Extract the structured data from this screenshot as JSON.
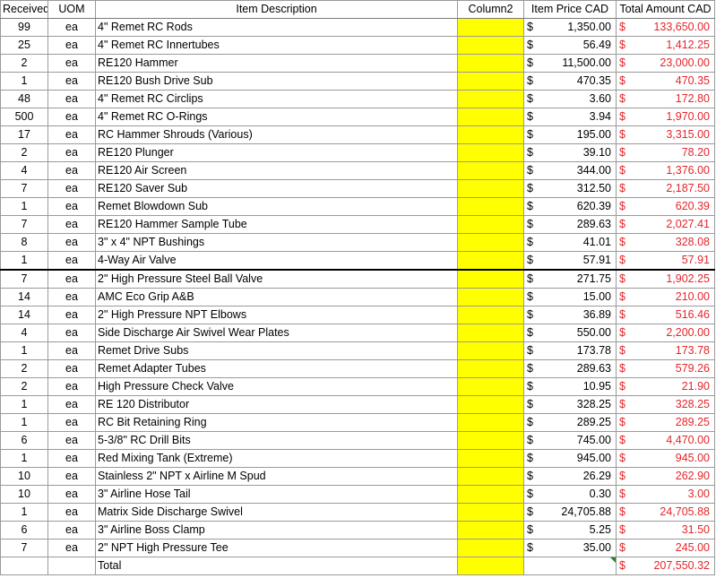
{
  "headers": {
    "received": "Received",
    "uom": "UOM",
    "description": "Item Description",
    "column2": "Column2",
    "price": "Item Price CAD",
    "total": "Total Amount CAD"
  },
  "currency_symbol": "$",
  "rows": [
    {
      "received": "99",
      "uom": "ea",
      "description": "4\" Remet RC Rods",
      "price": "1,350.00",
      "total": "133,650.00"
    },
    {
      "received": "25",
      "uom": "ea",
      "description": "4\" Remet RC Innertubes",
      "price": "56.49",
      "total": "1,412.25"
    },
    {
      "received": "2",
      "uom": "ea",
      "description": "RE120 Hammer",
      "price": "11,500.00",
      "total": "23,000.00"
    },
    {
      "received": "1",
      "uom": "ea",
      "description": "RE120 Bush Drive Sub",
      "price": "470.35",
      "total": "470.35"
    },
    {
      "received": "48",
      "uom": "ea",
      "description": "4\" Remet RC Circlips",
      "price": "3.60",
      "total": "172.80"
    },
    {
      "received": "500",
      "uom": "ea",
      "description": "4\" Remet RC O-Rings",
      "price": "3.94",
      "total": "1,970.00"
    },
    {
      "received": "17",
      "uom": "ea",
      "description": "RC Hammer Shrouds (Various)",
      "price": "195.00",
      "total": "3,315.00"
    },
    {
      "received": "2",
      "uom": "ea",
      "description": "RE120 Plunger",
      "price": "39.10",
      "total": "78.20"
    },
    {
      "received": "4",
      "uom": "ea",
      "description": "RE120 Air Screen",
      "price": "344.00",
      "total": "1,376.00"
    },
    {
      "received": "7",
      "uom": "ea",
      "description": "RE120 Saver Sub",
      "price": "312.50",
      "total": "2,187.50"
    },
    {
      "received": "1",
      "uom": "ea",
      "description": "Remet Blowdown Sub",
      "price": "620.39",
      "total": "620.39"
    },
    {
      "received": "7",
      "uom": "ea",
      "description": "RE120 Hammer Sample Tube",
      "price": "289.63",
      "total": "2,027.41"
    },
    {
      "received": "8",
      "uom": "ea",
      "description": "3\" x 4\" NPT Bushings",
      "price": "41.01",
      "total": "328.08"
    },
    {
      "received": "1",
      "uom": "ea",
      "description": "4-Way Air Valve",
      "price": "57.91",
      "total": "57.91"
    },
    {
      "received": "7",
      "uom": "ea",
      "description": "2\" High Pressure Steel Ball Valve",
      "price": "271.75",
      "total": "1,902.25"
    },
    {
      "received": "14",
      "uom": "ea",
      "description": "AMC Eco Grip A&B",
      "price": "15.00",
      "total": "210.00"
    },
    {
      "received": "14",
      "uom": "ea",
      "description": "2\" High Pressure NPT Elbows",
      "price": "36.89",
      "total": "516.46"
    },
    {
      "received": "4",
      "uom": "ea",
      "description": "Side Discharge Air Swivel Wear Plates",
      "price": "550.00",
      "total": "2,200.00"
    },
    {
      "received": "1",
      "uom": "ea",
      "description": "Remet Drive Subs",
      "price": "173.78",
      "total": "173.78"
    },
    {
      "received": "2",
      "uom": "ea",
      "description": "Remet Adapter Tubes",
      "price": "289.63",
      "total": "579.26"
    },
    {
      "received": "2",
      "uom": "ea",
      "description": "High Pressure Check Valve",
      "price": "10.95",
      "total": "21.90"
    },
    {
      "received": "1",
      "uom": "ea",
      "description": "RE 120 Distributor",
      "price": "328.25",
      "total": "328.25"
    },
    {
      "received": "1",
      "uom": "ea",
      "description": "RC Bit Retaining Ring",
      "price": "289.25",
      "total": "289.25"
    },
    {
      "received": "6",
      "uom": "ea",
      "description": "5-3/8\" RC Drill Bits",
      "price": "745.00",
      "total": "4,470.00"
    },
    {
      "received": "1",
      "uom": "ea",
      "description": "Red Mixing Tank (Extreme)",
      "price": "945.00",
      "total": "945.00"
    },
    {
      "received": "10",
      "uom": "ea",
      "description": "Stainless 2\" NPT x Airline M Spud",
      "price": "26.29",
      "total": "262.90"
    },
    {
      "received": "10",
      "uom": "ea",
      "description": "3\" Airline Hose Tail",
      "price": "0.30",
      "total": "3.00"
    },
    {
      "received": "1",
      "uom": "ea",
      "description": "Matrix Side Discharge Swivel",
      "price": "24,705.88",
      "total": "24,705.88"
    },
    {
      "received": "6",
      "uom": "ea",
      "description": "3\" Airline Boss Clamp",
      "price": "5.25",
      "total": "31.50"
    },
    {
      "received": "7",
      "uom": "ea",
      "description": "2\" NPT High Pressure Tee",
      "price": "35.00",
      "total": "245.00"
    }
  ],
  "total_row": {
    "label": "Total",
    "total": "207,550.32"
  }
}
